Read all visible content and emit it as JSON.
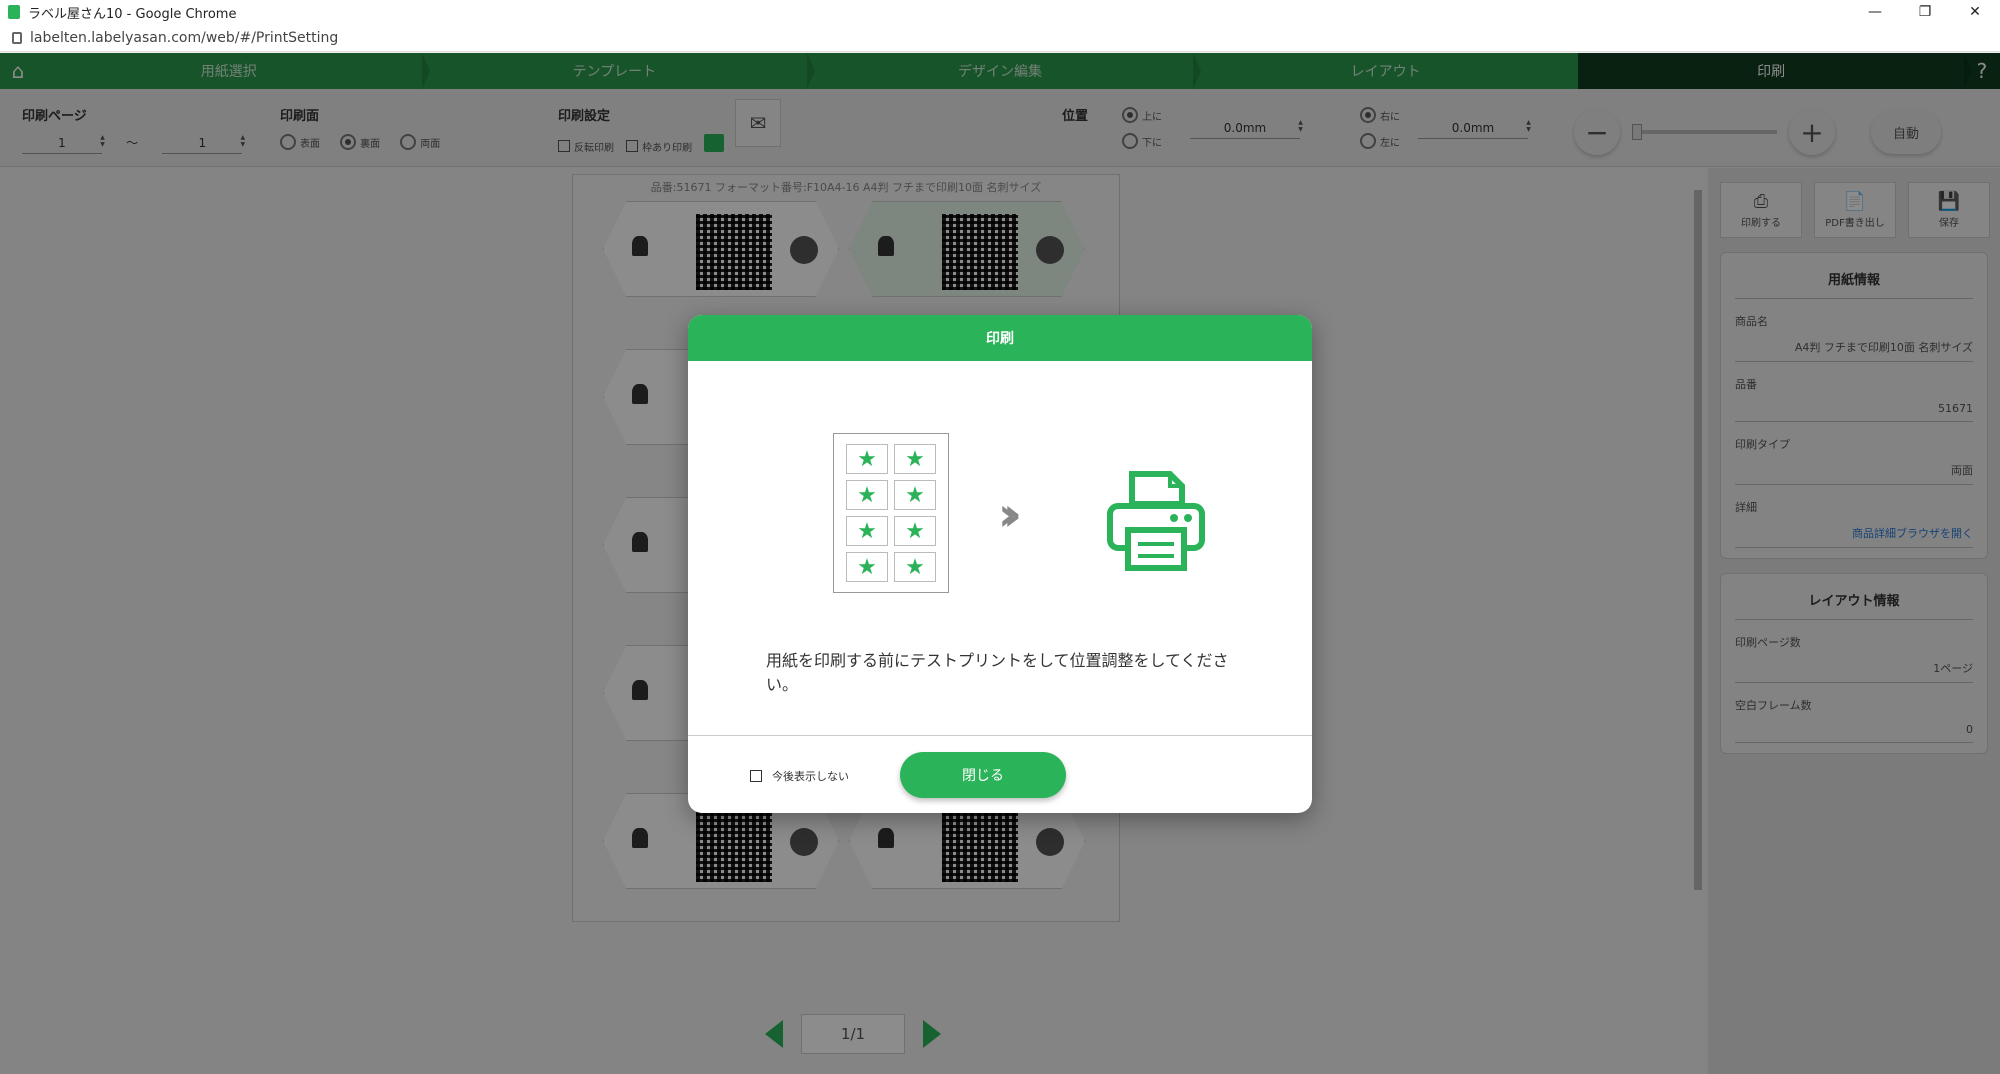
{
  "window": {
    "title": "ラベル屋さん10 - Google Chrome",
    "url": "labelten.labelyasan.com/web/#/PrintSetting",
    "controls": [
      "—",
      "❐",
      "✕"
    ]
  },
  "steps": [
    {
      "label": "用紙選択"
    },
    {
      "label": "テンプレート"
    },
    {
      "label": "デザイン編集"
    },
    {
      "label": "レイアウト"
    },
    {
      "label": "印刷"
    }
  ],
  "help_label": "?",
  "toolbar": {
    "print_page": {
      "title": "印刷ページ",
      "from": "1",
      "to": "1",
      "sep": "～"
    },
    "print_side": {
      "title": "印刷面",
      "options": [
        "表面",
        "裏面",
        "両面"
      ]
    },
    "print_settings": {
      "title": "印刷設定",
      "opt1": "反転印刷",
      "opt2": "枠あり印刷",
      "icon_label": "印刷設定"
    },
    "position": {
      "title": "位置",
      "top": "上に",
      "bottom": "下に",
      "v_value": "0.0mm",
      "right": "右に",
      "left": "左に",
      "h_value": "0.0mm"
    },
    "zoom": {
      "minus": "−",
      "plus": "+",
      "auto": "自動",
      "level": 0.0
    }
  },
  "canvas": {
    "caption": "品番:51671 フォーマット番号:F10A4-16 A4判 フチまで印刷10面 名刺サイズ"
  },
  "pager": {
    "label": "1/1"
  },
  "side": {
    "buttons": [
      {
        "icon": "printer-icon",
        "glyph": "⎙",
        "label": "印刷する"
      },
      {
        "icon": "pdf-icon",
        "glyph": "📄",
        "label": "PDF書き出し"
      },
      {
        "icon": "save-icon",
        "glyph": "💾",
        "label": "保存"
      }
    ],
    "paper_info": {
      "title": "用紙情報",
      "name_label": "商品名",
      "name_value": "A4判 フチまで印刷10面 名刺サイズ",
      "code_label": "品番",
      "code_value": "51671",
      "type_label": "印刷タイプ",
      "type_value": "両面",
      "detail_label": "詳細",
      "detail_value": "商品詳細ブラウザを開く"
    },
    "layout_info": {
      "title": "レイアウト情報",
      "pages_label": "印刷ページ数",
      "pages_value": "1ページ",
      "blank_label": "空白フレーム数",
      "blank_value": "0"
    }
  },
  "modal": {
    "title": "印刷",
    "message": "用紙を印刷する前にテストプリントをして位置調整をしてください。",
    "dont_show": "今後表示しない",
    "close": "閉じる"
  },
  "colors": {
    "accent": "#2bb35a",
    "step_active": "#0f3d1f"
  }
}
